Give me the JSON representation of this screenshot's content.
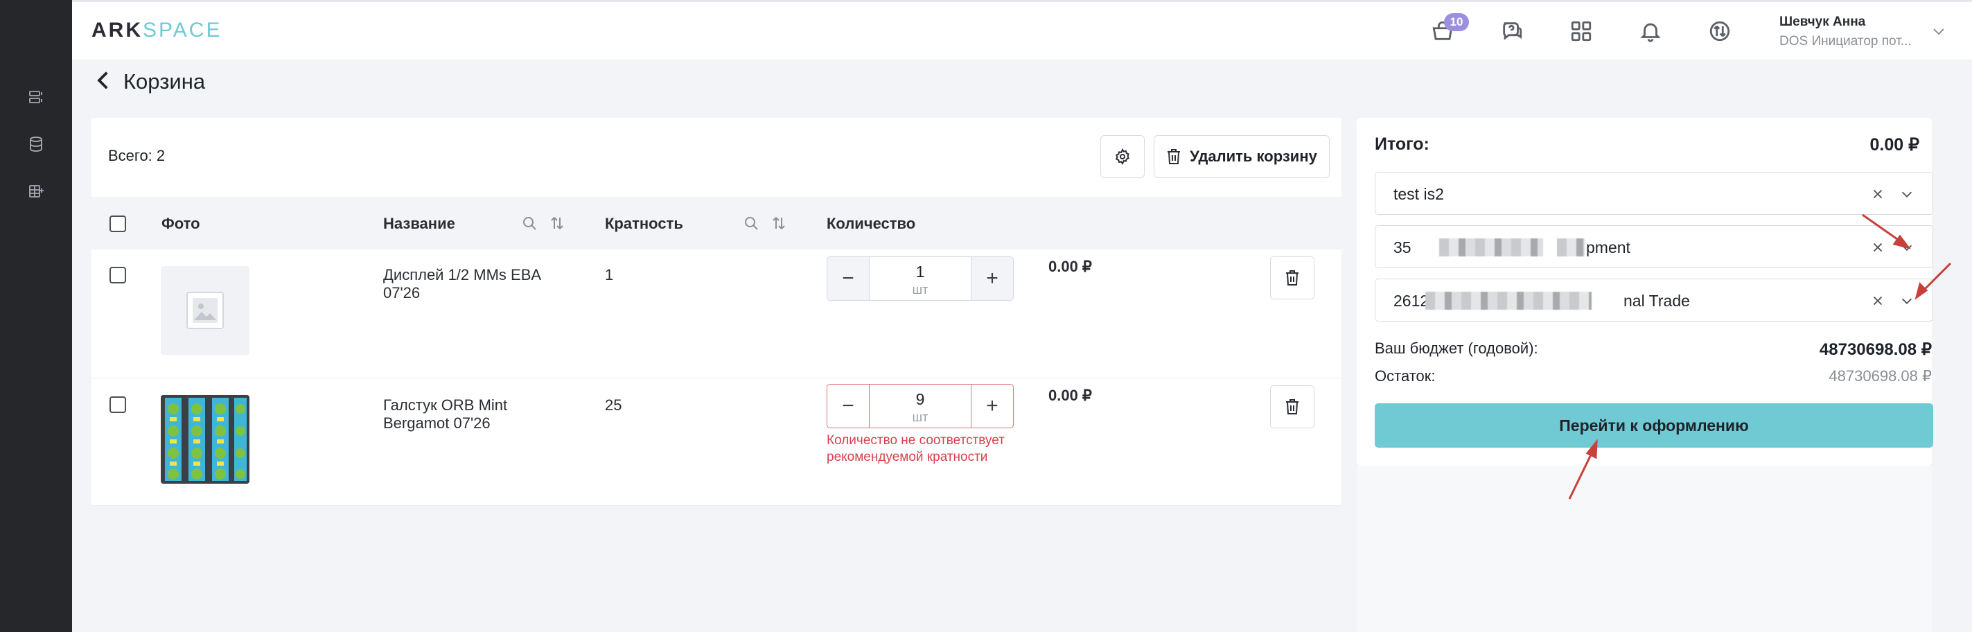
{
  "header": {
    "logo_part1": "ARK",
    "logo_part2": "SPACE",
    "cart_badge": "10",
    "user_name": "Шевчук Анна",
    "user_role": "DOS Инициатор пот..."
  },
  "page": {
    "title": "Корзина"
  },
  "cart": {
    "total_label": "Всего: 2",
    "clear_button": "Удалить корзину",
    "columns": {
      "photo": "Фото",
      "name": "Название",
      "multiplicity": "Кратность",
      "quantity": "Количество"
    },
    "rows": [
      {
        "name": "Дисплей 1/2 MMs EBA 07'26",
        "multiplicity": "1",
        "quantity": "1",
        "unit": "шт",
        "price": "0.00 ₽",
        "error": ""
      },
      {
        "name": "Галстук ORB Mint Bergamot 07'26",
        "multiplicity": "25",
        "quantity": "9",
        "unit": "шт",
        "price": "0.00 ₽",
        "error": "Количество не соответствует рекомендуемой кратности"
      }
    ]
  },
  "summary": {
    "total_label": "Итого:",
    "total_value": "0.00 ₽",
    "selects": [
      {
        "prefix": "test is2",
        "suffix": ""
      },
      {
        "prefix": "35",
        "suffix": "pment"
      },
      {
        "prefix": "2612",
        "suffix": "nal Trade"
      }
    ],
    "budget_label": "Ваш бюджет (годовой):",
    "budget_value": "48730698.08 ₽",
    "rest_label": "Остаток:",
    "rest_value": "48730698.08 ₽",
    "checkout_button": "Перейти к оформлению"
  },
  "colors": {
    "accent": "#6fcad3",
    "badge": "#9d8fe0",
    "error": "#d9414c",
    "annotation": "#c8403a"
  }
}
